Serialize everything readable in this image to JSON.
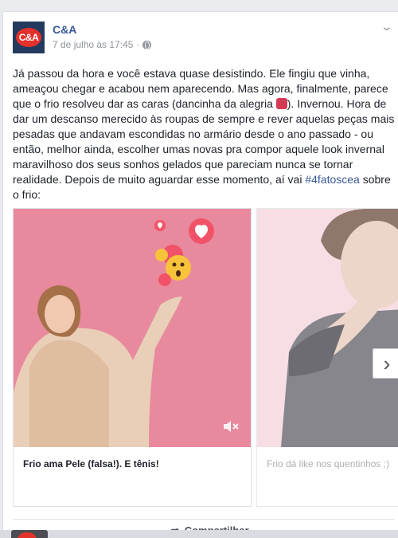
{
  "post": {
    "page_name": "C&A",
    "avatar_text": "C&A",
    "timestamp": "7 de julho às 17:45",
    "separator": "·",
    "body_before": "Já passou da hora e você estava quase desistindo. Ele fingiu que vinha, ameaçou chegar e acabou nem aparecendo. Mas agora, finalmente, parece que o frio resolveu dar as caras (dancinha da alegria ",
    "body_after": "). Invernou. Hora de dar um descanso merecido às roupas de sempre e rever aquelas peças mais pesadas que andavam escondidas no armário desde o ano passado - ou então, melhor ainda, escolher umas novas pra compor aquele look invernal maravilhoso dos seus sonhos gelados que pareciam nunca se tornar realidade. Depois de muito aguardar esse momento, aí vai ",
    "hashtag": "#4fatoscea",
    "body_end": " sobre o frio:"
  },
  "carousel": {
    "cards": [
      {
        "caption": "Frio ama Pele (falsa!). E tênis!"
      },
      {
        "caption": "Frio dá like nos quentinhos ;)"
      }
    ],
    "next_icon": "›"
  },
  "actions": {
    "share_label": "Compartilhar",
    "share_icon": "➦"
  },
  "icons": [
    "globe-icon",
    "chevron-down-icon",
    "mute-icon",
    "share-icon",
    "chevron-right-icon"
  ],
  "colors": {
    "link": "#385898",
    "brand_red": "#e4312b",
    "card1_bg": "#e8899e",
    "card2_bg": "#f3d3dc"
  }
}
